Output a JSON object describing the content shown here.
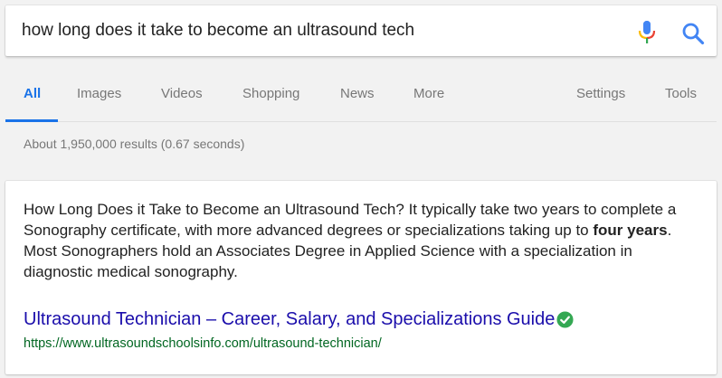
{
  "search": {
    "query": "how long does it take to become an ultrasound tech"
  },
  "tabs": [
    {
      "label": "All",
      "active": true
    },
    {
      "label": "Images"
    },
    {
      "label": "Videos"
    },
    {
      "label": "Shopping"
    },
    {
      "label": "News"
    },
    {
      "label": "More"
    }
  ],
  "tools": {
    "settings_label": "Settings",
    "tools_label": "Tools"
  },
  "result_stats": "About 1,950,000 results (0.67 seconds)",
  "snippet": {
    "text_before": "How Long Does it Take to Become an Ultrasound Tech? It typically take two years to complete a Sonography certificate, with more advanced degrees or specializations taking up to ",
    "bold": "four years",
    "text_after": ". Most Sonographers hold an Associates Degree in Applied Science with a specialization in diagnostic medical sonography.",
    "title": "Ultrasound Technician – Career, Salary, and Specializations Guide",
    "url": "https://www.ultrasoundschoolsinfo.com/ultrasound-technician/"
  },
  "colors": {
    "link_blue": "#1a0dab",
    "url_green": "#006621",
    "accent_blue": "#1a73e8",
    "verified_green": "#34a853"
  }
}
